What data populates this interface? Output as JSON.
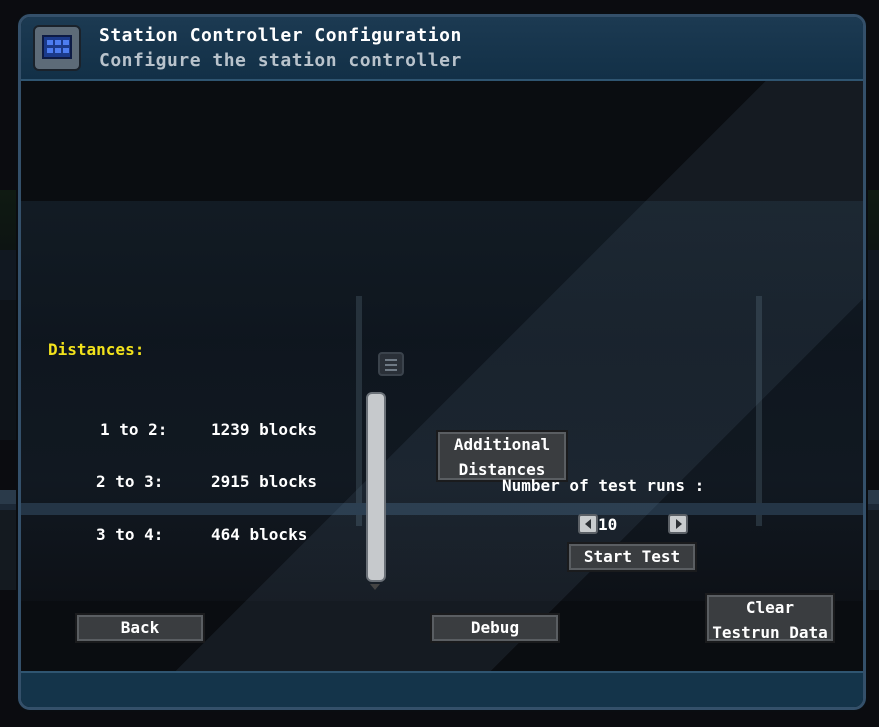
{
  "window": {
    "title": "Station Controller Configuration",
    "subtitle": "Configure the station controller",
    "icon": "station-controller-icon"
  },
  "distances": {
    "label": "Distances:",
    "rows": [
      {
        "key": "1 to 2:",
        "value": "1239 blocks"
      },
      {
        "key": "2 to 3:",
        "value": "2915 blocks"
      },
      {
        "key": "3 to 4:",
        "value": "464 blocks"
      }
    ]
  },
  "buttons": {
    "additional_distances_line1": "Additional",
    "additional_distances_line2": "Distances",
    "start_test": "Start Test",
    "back": "Back",
    "debug": "Debug",
    "clear_line1": "Clear",
    "clear_line2": "Testrun Data"
  },
  "test_runs": {
    "label": "Number of test runs :",
    "value": "10"
  },
  "colors": {
    "accent_yellow": "#f2e21c",
    "header_blue": "#1c3a52",
    "button_gray": "#3a3d40"
  }
}
